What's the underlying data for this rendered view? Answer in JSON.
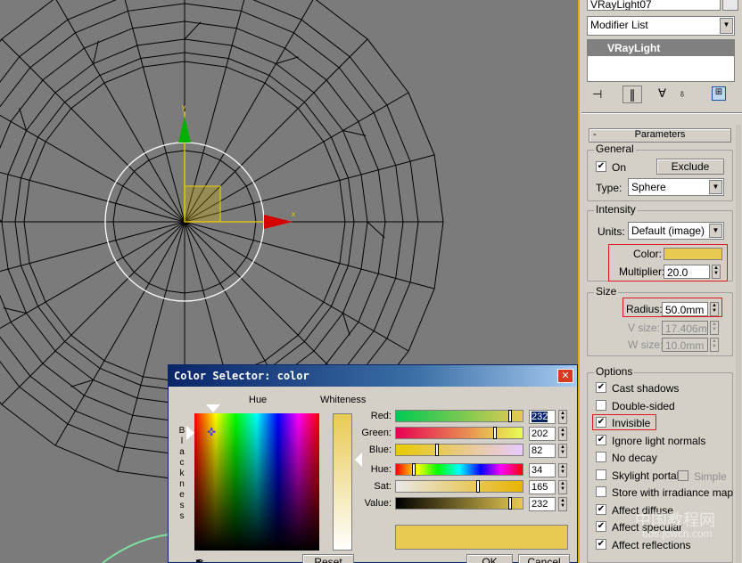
{
  "top_field_value": "VRayLight07",
  "modifier_list": "Modifier List",
  "modifier_stack_item": "VRayLight",
  "toolbar_icons": [
    "pin-stack-icon",
    "show-end-result-icon",
    "make-unique-icon",
    "remove-modifier-icon",
    "configure-modifier-sets-icon"
  ],
  "rollout": {
    "toggle": "-",
    "title": "Parameters"
  },
  "general": {
    "title": "General",
    "on_label": "On",
    "on_checked": true,
    "exclude_label": "Exclude",
    "type_label": "Type:",
    "type_value": "Sphere"
  },
  "intensity": {
    "title": "Intensity",
    "units_label": "Units:",
    "units_value": "Default (image)",
    "color_label": "Color:",
    "color_value": "#e8ca52",
    "multiplier_label": "Multiplier:",
    "multiplier_value": "20.0"
  },
  "size": {
    "title": "Size",
    "radius_label": "Radius:",
    "radius_value": "50.0mm",
    "vsize_label": "V size:",
    "vsize_value": "17.406mm",
    "wsize_label": "W size:",
    "wsize_value": "10.0mm"
  },
  "options": {
    "title": "Options",
    "items": [
      {
        "label": "Cast shadows",
        "checked": true
      },
      {
        "label": "Double-sided",
        "checked": false
      },
      {
        "label": "Invisible",
        "checked": true
      },
      {
        "label": "Ignore light normals",
        "checked": true
      },
      {
        "label": "No decay",
        "checked": false
      },
      {
        "label": "Skylight portal",
        "checked": false
      },
      {
        "label": "Store with irradiance map",
        "checked": false
      },
      {
        "label": "Affect diffuse",
        "checked": true
      },
      {
        "label": "Affect specular",
        "checked": true
      },
      {
        "label": "Affect reflections",
        "checked": true
      }
    ],
    "simple_label": "Simple"
  },
  "viewport": {
    "axis_x": "x",
    "axis_y": "y"
  },
  "dialog": {
    "title": "Color Selector: color",
    "hue_header": "Hue",
    "whiteness_header": "Whiteness",
    "blackness_label": "Blackness",
    "sliders": [
      {
        "label": "Red:",
        "value": "232",
        "fraction": 0.91
      },
      {
        "label": "Green:",
        "value": "202",
        "fraction": 0.79
      },
      {
        "label": "Blue:",
        "value": "82",
        "fraction": 0.32
      },
      {
        "label": "Hue:",
        "value": "34",
        "fraction": 0.13
      },
      {
        "label": "Sat:",
        "value": "165",
        "fraction": 0.65
      },
      {
        "label": "Value:",
        "value": "232",
        "fraction": 0.91
      }
    ],
    "swatch_color": "#e8ca52",
    "reset_label": "Reset",
    "ok_label": "OK",
    "cancel_label": "Cancel"
  },
  "watermark": "中国教程网",
  "watermark_url": "bbs.jcwcn.com"
}
